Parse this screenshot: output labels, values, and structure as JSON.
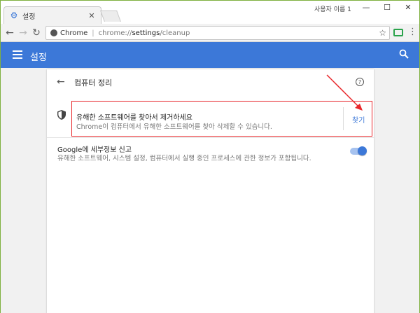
{
  "browser": {
    "tab_title": "설정",
    "tab_close": "✕",
    "profile_name": "사용자 이름 1",
    "window_controls": {
      "minimize": "—",
      "maximize": "☐",
      "close": "✕"
    },
    "toolbar": {
      "back": "←",
      "forward": "→",
      "reload": "↻",
      "omnibox_label": "Chrome",
      "omnibox_sep": "|",
      "url_prefix": "chrome://",
      "url_bold": "settings",
      "url_suffix": "/cleanup",
      "star": "☆",
      "menu": "⋮"
    }
  },
  "header": {
    "title": "설정"
  },
  "page": {
    "back": "←",
    "title": "컴퓨터 정리",
    "help": "?",
    "cleanup": {
      "title": "유해한 소프트웨어를 찾아서 제거하세요",
      "description": "Chrome이 컴퓨터에서 유해한 소프트웨어를 찾아 삭제할 수 있습니다.",
      "button": "찾기"
    },
    "report": {
      "title": "Google에 세부정보 신고",
      "description": "유해한 소프트웨어, 시스템 설정, 컴퓨터에서 실행 중인 프로세스에 관한 정보가 포함됩니다.",
      "enabled": true
    }
  },
  "colors": {
    "accent": "#3c78d8",
    "highlight": "#e8262a"
  }
}
